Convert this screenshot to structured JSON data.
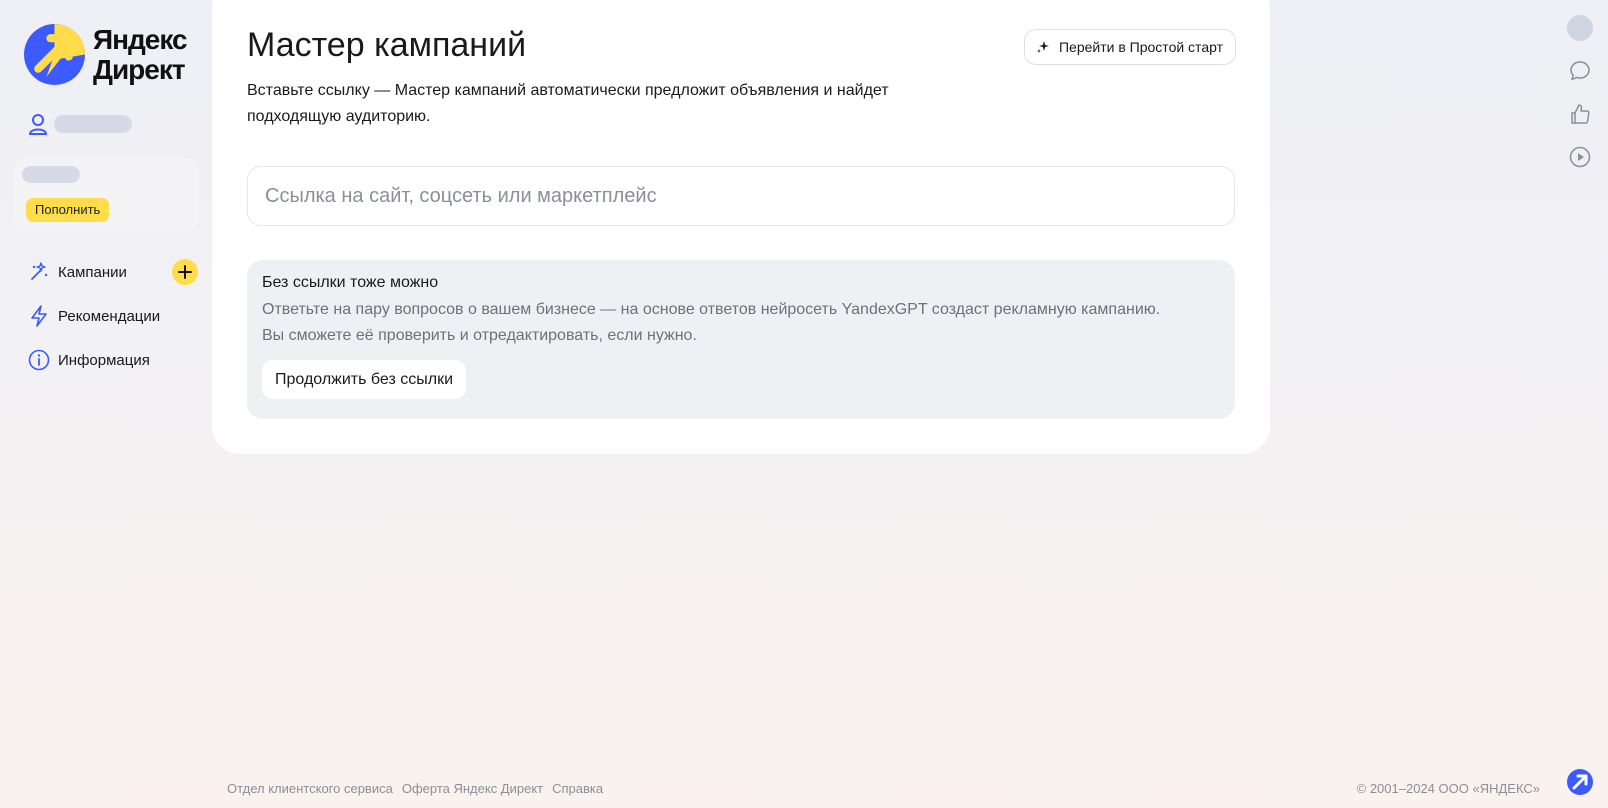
{
  "brand": {
    "line1": "Яндекс",
    "line2": "Директ",
    "accent": "#ffdc4a",
    "blue": "#3d5afe"
  },
  "sidebar": {
    "topup_label": "Пополнить",
    "items": [
      {
        "label": "Кампании",
        "icon": "magic-sparkle-icon"
      },
      {
        "label": "Рекомендации",
        "icon": "lightning-icon"
      },
      {
        "label": "Информация",
        "icon": "info-icon"
      }
    ]
  },
  "main": {
    "title": "Мастер кампаний",
    "subtitle": "Вставьте ссылку — Мастер кампаний автоматически предложит объявления и найдет подходящую аудиторию.",
    "simple_start_label": "Перейти в Простой старт",
    "url_placeholder": "Ссылка на сайт, соцсеть или маркетплейс",
    "nolink": {
      "title": "Без ссылки тоже можно",
      "text": "Ответьте на пару вопросов о вашем бизнесе — на основе ответов нейросеть YandexGPT создаст рекламную кампанию. Вы сможете её проверить и отредактировать, если нужно.",
      "button_label": "Продолжить без ссылки"
    }
  },
  "rail": {
    "icons": [
      "avatar",
      "chat-icon",
      "thumbs-up-icon",
      "play-icon"
    ]
  },
  "footer": {
    "links": [
      "Отдел клиентского сервиса",
      "Оферта Яндекс Директ",
      "Справка"
    ],
    "copyright": "© 2001–2024 ООО «ЯНДЕКС»"
  }
}
